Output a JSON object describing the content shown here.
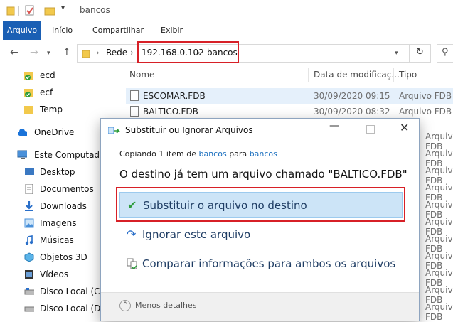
{
  "window": {
    "title": "bancos"
  },
  "ribbon": {
    "tabs": [
      "Arquivo",
      "Início",
      "Compartilhar",
      "Exibir"
    ]
  },
  "address": {
    "crumbs": [
      "Rede",
      "192.168.0.102",
      "bancos"
    ]
  },
  "sidebar": {
    "items": [
      {
        "label": "ecd",
        "icon": "folder-check-icon"
      },
      {
        "label": "ecf",
        "icon": "folder-check-icon"
      },
      {
        "label": "Temp",
        "icon": "folder-icon"
      },
      {
        "label": "OneDrive",
        "icon": "cloud-icon"
      },
      {
        "label": "Este Computador",
        "icon": "computer-icon"
      },
      {
        "label": "Desktop",
        "icon": "desktop-icon"
      },
      {
        "label": "Documentos",
        "icon": "documents-icon"
      },
      {
        "label": "Downloads",
        "icon": "download-icon"
      },
      {
        "label": "Imagens",
        "icon": "images-icon"
      },
      {
        "label": "Músicas",
        "icon": "music-icon"
      },
      {
        "label": "Objetos 3D",
        "icon": "cube-icon"
      },
      {
        "label": "Vídeos",
        "icon": "video-icon"
      },
      {
        "label": "Disco Local (C:)",
        "icon": "drive-icon"
      },
      {
        "label": "Disco Local (D:)",
        "icon": "drive-icon"
      }
    ]
  },
  "filelist": {
    "columns": [
      "Nome",
      "Data de modificaç...",
      "Tipo"
    ],
    "rows": [
      {
        "name": "ESCOMAR.FDB",
        "date": "30/09/2020 09:15",
        "type": "Arquivo FDB"
      },
      {
        "name": "BALTICO.FDB",
        "date": "30/09/2020 08:32",
        "type": "Arquivo FDB"
      }
    ]
  },
  "dialog": {
    "title": "Substituir ou Ignorar Arquivos",
    "copying_prefix": "Copiando 1 item de",
    "copying_from": "bancos",
    "copying_mid": "para",
    "copying_to": "bancos",
    "headline": "O destino já tem um arquivo chamado \"BALTICO.FDB\"",
    "options": [
      {
        "label": "Substituir o arquivo no destino",
        "icon": "check-icon"
      },
      {
        "label": "Ignorar este arquivo",
        "icon": "skip-icon"
      },
      {
        "label": "Comparar informações para ambos os arquivos",
        "icon": "compare-icon"
      }
    ],
    "less_details": "Menos detalhes"
  },
  "colors": {
    "accent": "#1a5fb4",
    "highlight": "#d72027",
    "selection": "#cce4f7"
  }
}
